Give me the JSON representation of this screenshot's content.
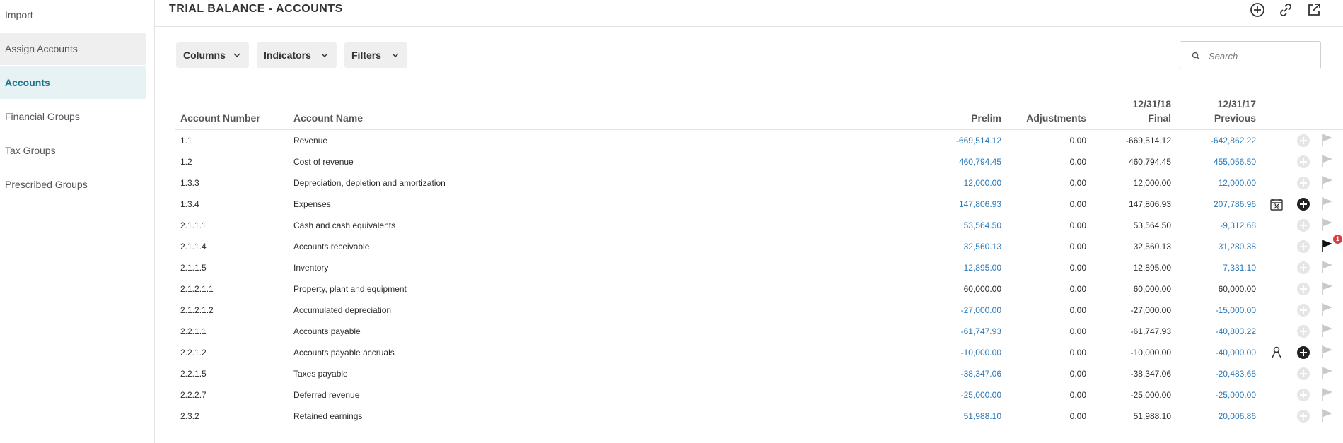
{
  "sidebar": {
    "items": [
      {
        "label": "Import"
      },
      {
        "label": "Assign Accounts"
      },
      {
        "label": "Accounts"
      },
      {
        "label": "Financial Groups"
      },
      {
        "label": "Tax Groups"
      },
      {
        "label": "Prescribed Groups"
      }
    ]
  },
  "header": {
    "title": "TRIAL BALANCE - ACCOUNTS",
    "icons": [
      "add-circle-icon",
      "link-icon",
      "open-external-icon"
    ]
  },
  "toolbar": {
    "columns_label": "Columns",
    "indicators_label": "Indicators",
    "filters_label": "Filters",
    "search_placeholder": "Search"
  },
  "table": {
    "headers": {
      "account_number": "Account Number",
      "account_name": "Account Name",
      "prelim": "Prelim",
      "adjustments": "Adjustments",
      "final_date": "12/31/18",
      "final": "Final",
      "previous_date": "12/31/17",
      "previous": "Previous"
    },
    "rows": [
      {
        "number": "1.1",
        "name": "Revenue",
        "prelim": "-669,514.12",
        "adjustments": "0.00",
        "final": "-669,514.12",
        "previous": "-642,862.22"
      },
      {
        "number": "1.2",
        "name": "Cost of revenue",
        "prelim": "460,794.45",
        "adjustments": "0.00",
        "final": "460,794.45",
        "previous": "455,056.50"
      },
      {
        "number": "1.3.3",
        "name": "Depreciation, depletion and amortization",
        "prelim": "12,000.00",
        "adjustments": "0.00",
        "final": "12,000.00",
        "previous": "12,000.00"
      },
      {
        "number": "1.3.4",
        "name": "Expenses",
        "prelim": "147,806.93",
        "adjustments": "0.00",
        "final": "147,806.93",
        "previous": "207,786.96",
        "indicator": "percent-calendar-icon",
        "add_active": true
      },
      {
        "number": "2.1.1.1",
        "name": "Cash and cash equivalents",
        "prelim": "53,564.50",
        "adjustments": "0.00",
        "final": "53,564.50",
        "previous": "-9,312.68"
      },
      {
        "number": "2.1.1.4",
        "name": "Accounts receivable",
        "prelim": "32,560.13",
        "adjustments": "0.00",
        "final": "32,560.13",
        "previous": "31,280.38",
        "flag_active": true,
        "flag_count": "1"
      },
      {
        "number": "2.1.1.5",
        "name": "Inventory",
        "prelim": "12,895.00",
        "adjustments": "0.00",
        "final": "12,895.00",
        "previous": "7,331.10"
      },
      {
        "number": "2.1.2.1.1",
        "name": "Property, plant and equipment",
        "prelim": "60,000.00",
        "adjustments": "0.00",
        "final": "60,000.00",
        "previous": "60,000.00",
        "plain": true
      },
      {
        "number": "2.1.2.1.2",
        "name": "Accumulated depreciation",
        "prelim": "-27,000.00",
        "adjustments": "0.00",
        "final": "-27,000.00",
        "previous": "-15,000.00"
      },
      {
        "number": "2.2.1.1",
        "name": "Accounts payable",
        "prelim": "-61,747.93",
        "adjustments": "0.00",
        "final": "-61,747.93",
        "previous": "-40,803.22"
      },
      {
        "number": "2.2.1.2",
        "name": "Accounts payable accruals",
        "prelim": "-10,000.00",
        "adjustments": "0.00",
        "final": "-10,000.00",
        "previous": "-40,000.00",
        "indicator": "ribbon-icon",
        "add_active": true
      },
      {
        "number": "2.2.1.5",
        "name": "Taxes payable",
        "prelim": "-38,347.06",
        "adjustments": "0.00",
        "final": "-38,347.06",
        "previous": "-20,483.68"
      },
      {
        "number": "2.2.2.7",
        "name": "Deferred revenue",
        "prelim": "-25,000.00",
        "adjustments": "0.00",
        "final": "-25,000.00",
        "previous": "-25,000.00"
      },
      {
        "number": "2.3.2",
        "name": "Retained earnings",
        "prelim": "51,988.10",
        "adjustments": "0.00",
        "final": "51,988.10",
        "previous": "20,006.86"
      }
    ]
  },
  "colors": {
    "link": "#2a78b8",
    "active_nav_text": "#1d7488",
    "active_nav_bg": "#e7f2f4",
    "badge": "#d93f3f"
  }
}
